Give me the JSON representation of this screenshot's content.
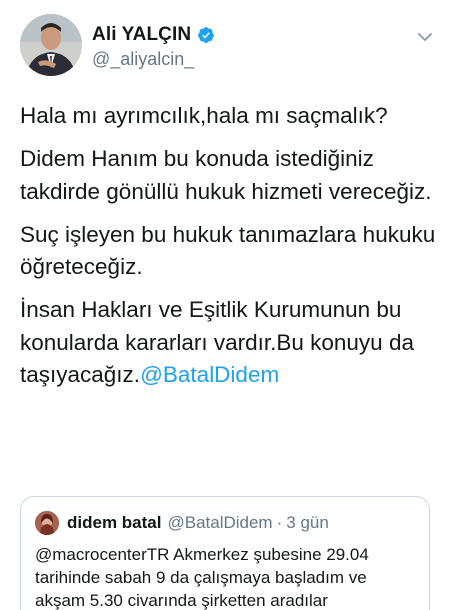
{
  "author": {
    "display_name": "Ali YALÇIN",
    "handle": "@_aliyalcin_",
    "verified_icon": "verified-badge-icon",
    "verified_color": "#1da1f2"
  },
  "tweet": {
    "paragraphs": [
      "Hala mı ayrımcılık,hala mı saçmalık?",
      "Didem Hanım bu konuda istediğiniz takdirde gönüllü hukuk hizmeti vereceğiz.",
      "Suç işleyen bu hukuk tanımazlara hukuku öğreteceğiz.",
      "İnsan Hakları ve Eşitlik Kurumunun bu konularda kararları vardır.Bu konuyu da taşıyacağız."
    ],
    "mention": "@BatalDidem"
  },
  "quoted": {
    "name": "didem batal",
    "handle": "@BatalDidem",
    "separator": "·",
    "time": "3 gün",
    "text": "@macrocenterTR Akmerkez şubesine 29.04 tarihinde sabah 9 da çalışmaya başladım ve akşam 5.30 civarında şirketten aradılar"
  },
  "colors": {
    "text": "#14171a",
    "secondary": "#657786",
    "link": "#1da1f2",
    "border": "#ccd6dd"
  }
}
